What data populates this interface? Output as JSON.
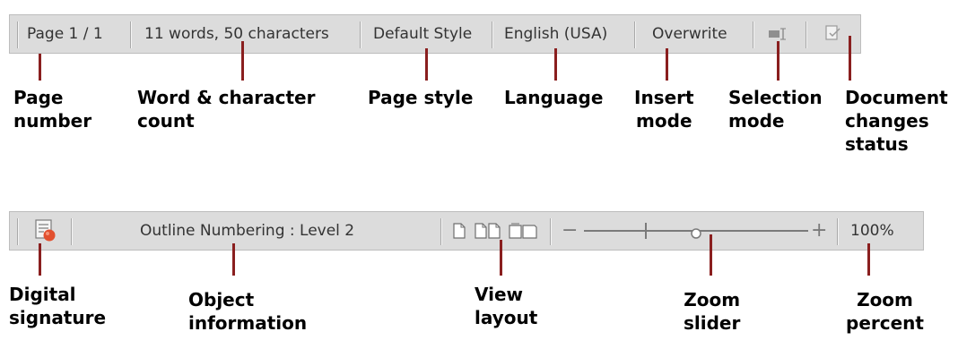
{
  "top_bar": {
    "page_number": "Page 1 / 1",
    "word_count": "11 words, 50 characters",
    "page_style": "Default Style",
    "language": "English (USA)",
    "insert_mode": "Overwrite"
  },
  "top_callouts": {
    "page_number": "Page\nnumber",
    "word_count": "Word & character\ncount",
    "page_style": "Page style",
    "language": "Language",
    "insert_mode": "Insert\nmode",
    "selection_mode": "Selection\nmode",
    "changes_status": "Document\nchanges\nstatus"
  },
  "bottom_bar": {
    "object_info": "Outline Numbering : Level 2",
    "zoom_minus": "−",
    "zoom_plus": "+",
    "zoom_percent": "100%"
  },
  "bottom_callouts": {
    "digital_signature": "Digital\nsignature",
    "object_info": "Object\ninformation",
    "view_layout": "View\nlayout",
    "zoom_slider": "Zoom\nslider",
    "zoom_percent": "Zoom\npercent"
  },
  "colors": {
    "pointer": "#8a1f1f",
    "bar_background": "#dcdcdc"
  },
  "icons": [
    "selection-mode-icon",
    "document-changes-icon",
    "digital-signature-icon",
    "single-page-icon",
    "two-page-icon",
    "book-view-icon",
    "zoom-slider-thumb-icon"
  ],
  "zoom": {
    "slider_level": 0.5
  }
}
